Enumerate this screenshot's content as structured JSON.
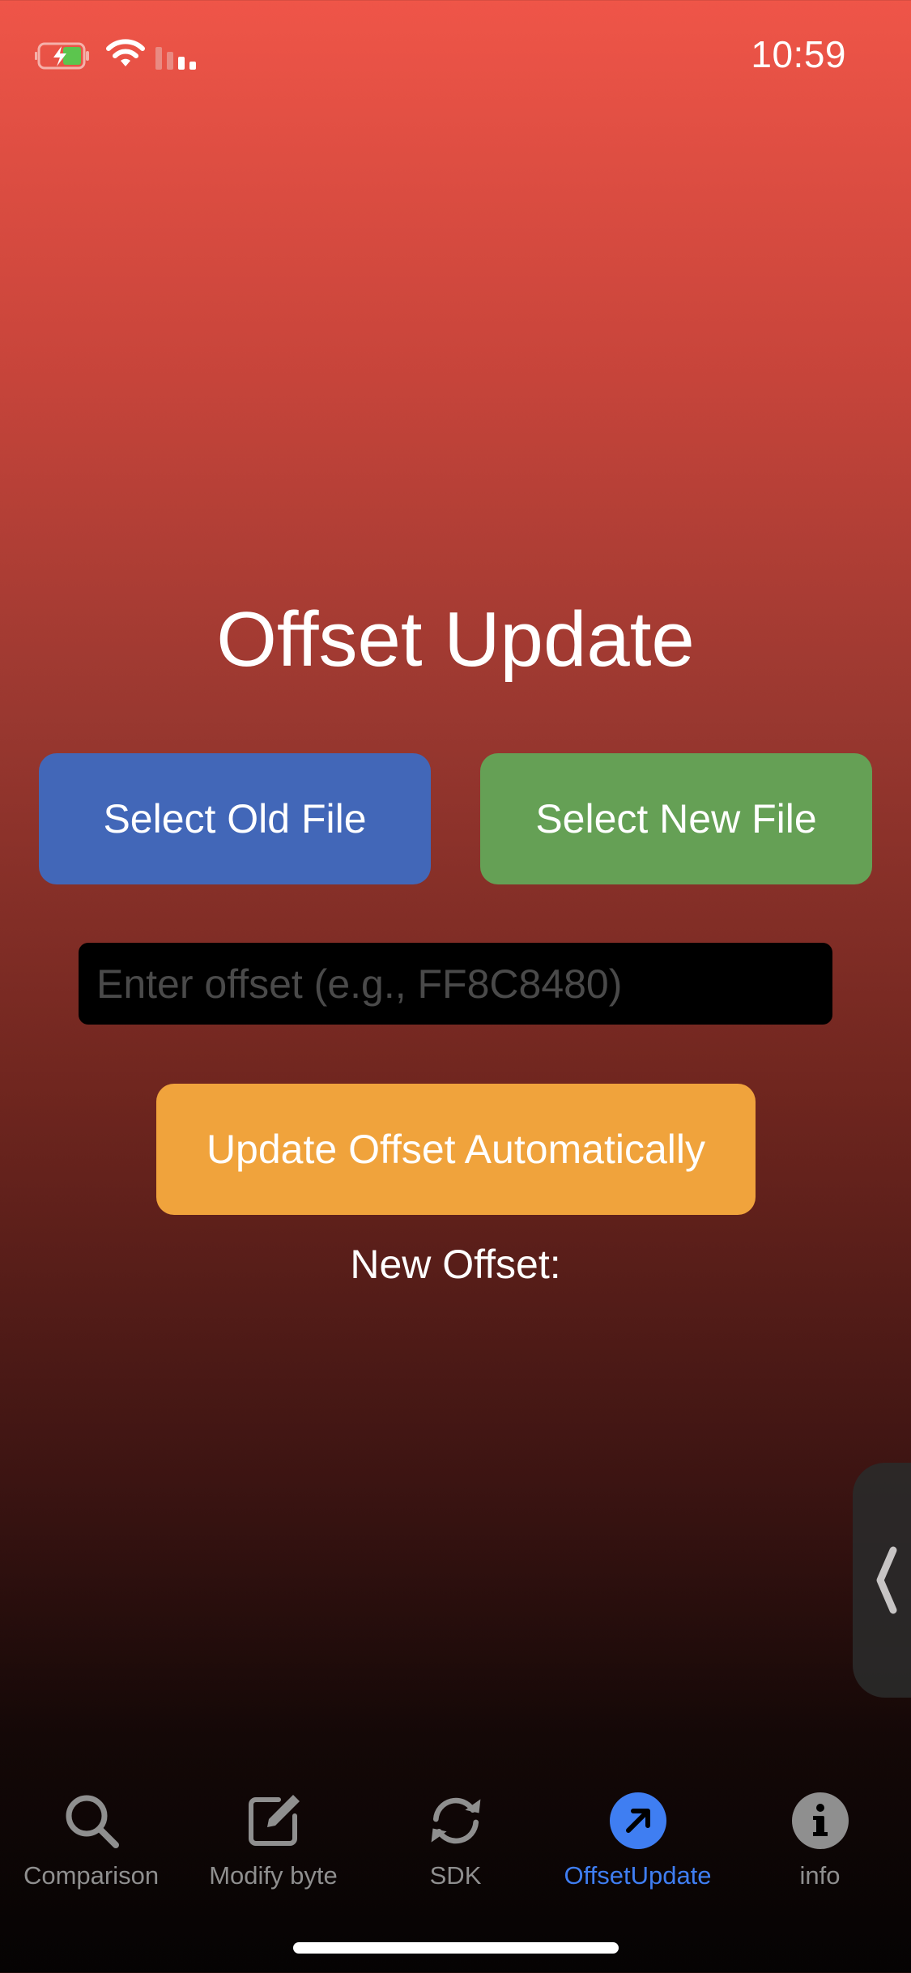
{
  "status_bar": {
    "time": "10:59",
    "icons": [
      "battery-charging-icon",
      "wifi-icon",
      "cellular-signal-icon"
    ]
  },
  "page": {
    "title": "Offset Update",
    "select_old_label": "Select Old File",
    "select_new_label": "Select New File",
    "offset_input": {
      "value": "",
      "placeholder": "Enter offset (e.g., FF8C8480)"
    },
    "update_label": "Update Offset Automatically",
    "result_label": "New Offset:"
  },
  "colors": {
    "old_button": "#4267b8",
    "new_button": "#65a055",
    "update_button": "#f0a33c",
    "active_tab": "#3f7ef2",
    "inactive_tab": "#8f8f8f"
  },
  "tab_bar": {
    "active": "OffsetUpdate",
    "tabs": [
      {
        "label": "Comparison",
        "icon": "magnifying-glass-icon"
      },
      {
        "label": "Modify byte",
        "icon": "square-pencil-icon"
      },
      {
        "label": "SDK",
        "icon": "refresh-arrows-icon"
      },
      {
        "label": "OffsetUpdate",
        "icon": "arrow-up-right-circle-icon"
      },
      {
        "label": "info",
        "icon": "info-circle-icon"
      }
    ]
  }
}
